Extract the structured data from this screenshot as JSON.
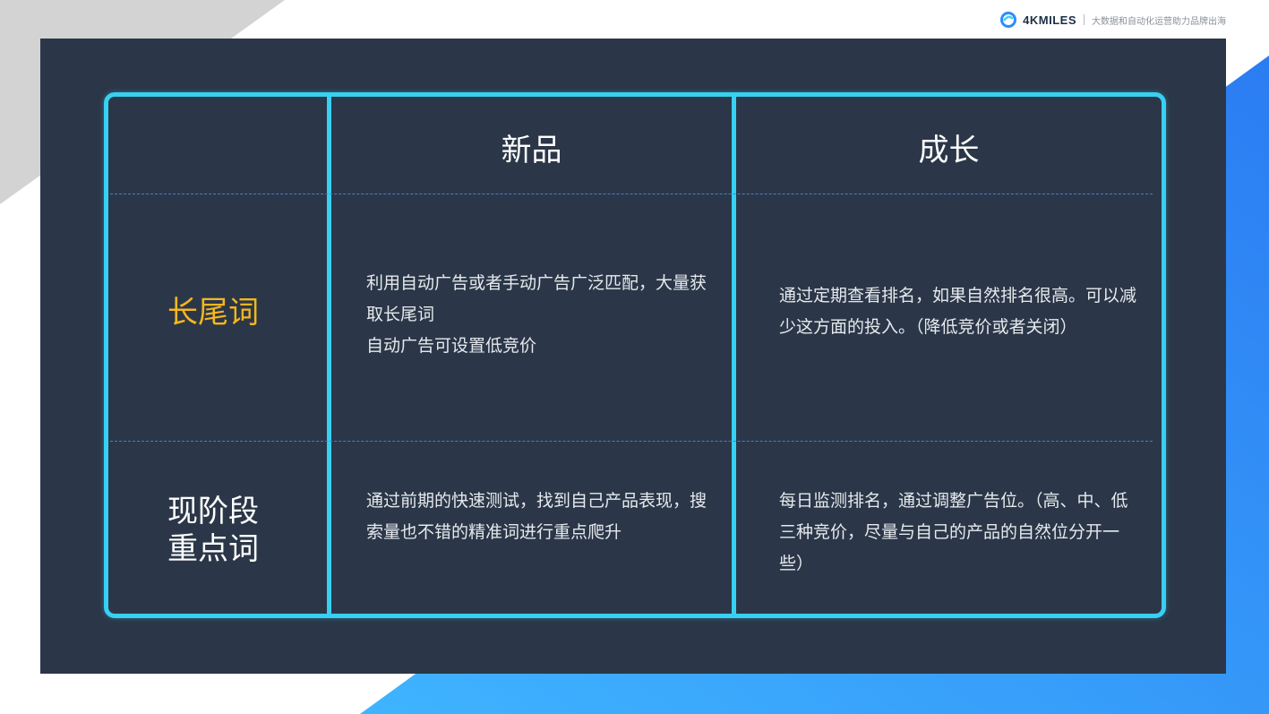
{
  "brand": {
    "logo_text": "4KMILES",
    "tagline": "大数据和自动化运营助力品牌出海",
    "icon": "4kmiles-logo-icon",
    "accent_color": "#2d8cff"
  },
  "colors": {
    "panel": "#2b3748",
    "table_border": "#37d0f2",
    "highlight_text": "#f5b61f"
  },
  "table": {
    "headers": [
      "新品",
      "成长"
    ],
    "rows": [
      {
        "label": "长尾词",
        "cells": [
          " 利用自动广告或者手动广告广泛匹配，大量获取长尾词\n自动广告可设置低竞价",
          "通过定期查看排名，如果自然排名很高。可以减少这方面的投入。（降低竞价或者关闭）"
        ]
      },
      {
        "label": "现阶段\n重点词",
        "cells": [
          "通过前期的快速测试，找到自己产品表现，搜索量也不错的精准词进行重点爬升",
          "每日监测排名，通过调整广告位。（高、中、低三种竞价，尽量与自己的产品的自然位分开一些）"
        ]
      }
    ]
  }
}
